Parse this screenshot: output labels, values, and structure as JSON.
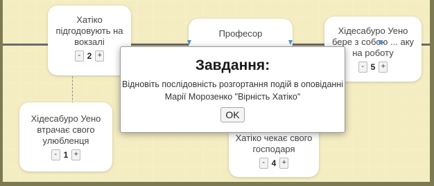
{
  "cards": [
    {
      "id": "c2",
      "text": "Хатіко підгодовують на вокзалі",
      "num": "2"
    },
    {
      "id": "cprof",
      "text": "Професор",
      "num": ""
    },
    {
      "id": "c5",
      "text": "Хідесабуро Уено бере з собою ... аку на роботу",
      "num": "5"
    },
    {
      "id": "c1",
      "text": "Хідесабуро Уено втрачає свого улюбленця",
      "num": "1"
    },
    {
      "id": "c4",
      "text": "Хатіко чекає свого господаря",
      "num": "4"
    }
  ],
  "stepper": {
    "minus": "-",
    "plus": "+"
  },
  "dialog": {
    "title": "Завдання:",
    "message": "Відновіть послідовність розгортання подій в оповіданні Марії Морозенко \"Вірність Хатіко\"",
    "ok": "OK"
  },
  "colors": {
    "board": "#f5edc2",
    "pin": "#4a90d9",
    "frame": "#7c7a53"
  }
}
